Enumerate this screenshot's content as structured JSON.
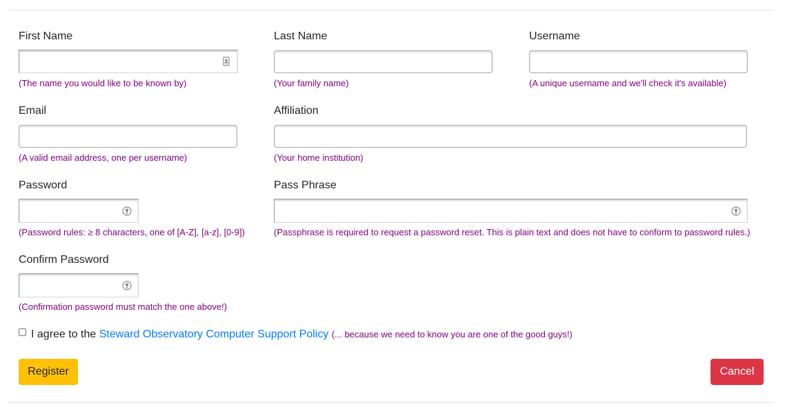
{
  "form": {
    "first_name": {
      "label": "First Name",
      "value": "",
      "hint": "(The name you would like to be known by)"
    },
    "last_name": {
      "label": "Last Name",
      "value": "",
      "hint": "(Your family name)"
    },
    "username": {
      "label": "Username",
      "value": "",
      "hint": "(A unique username and we'll check it's available)"
    },
    "email": {
      "label": "Email",
      "value": "",
      "hint": "(A valid email address, one per username)"
    },
    "affiliation": {
      "label": "Affiliation",
      "value": "",
      "hint": "(Your home institution)"
    },
    "password": {
      "label": "Password",
      "value": "",
      "hint": "(Password rules: ≥ 8 characters, one of [A-Z], [a-z], [0-9])"
    },
    "pass_phrase": {
      "label": "Pass Phrase",
      "value": "",
      "hint": "(Passphrase is required to request a password reset. This is plain text and does not have to conform to password rules.)"
    },
    "confirm_password": {
      "label": "Confirm Password",
      "value": "",
      "hint": "(Confirmation password must match the one above!)"
    }
  },
  "agreement": {
    "checked": false,
    "prefix": "I agree to the",
    "link_text": "Steward Observatory Computer Support Policy",
    "suffix": "(... because we need to know you are one of the good guys!)"
  },
  "buttons": {
    "register": "Register",
    "cancel": "Cancel"
  },
  "colors": {
    "hint": "#800080",
    "link": "#007bff",
    "register": "#ffc107",
    "cancel": "#dc3545"
  },
  "icons": {
    "contact_card": "contact-card-icon",
    "password_key": "password-key-icon"
  }
}
